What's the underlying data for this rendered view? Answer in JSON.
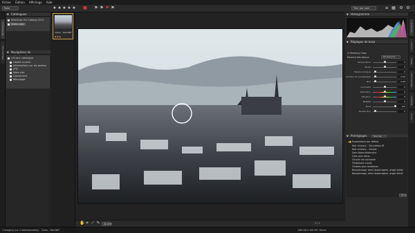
{
  "menu": [
    "Fichier",
    "Édition",
    "Affichage",
    "Aide"
  ],
  "toolbar": {
    "left_field": "Note",
    "right_field": "Trier par nom",
    "icons": [
      "back-icon",
      "forward-icon",
      "star-icon",
      "flag-icon",
      "rotate-icon",
      "settings-icon"
    ]
  },
  "left_tabs": [
    "Bibliothèque",
    "Métadonnées"
  ],
  "catalogs": {
    "title": "Catalogues",
    "items": [
      "AfterShot Pro Catalog 2012",
      "Vidéo.cata"
    ]
  },
  "metadata_nav": {
    "title": "Navigateur de métadonnées",
    "items": [
      "Cet jour catalogue",
      "Libellé couleur",
      "Informations sur les photos",
      "IPTC",
      "Mots-clés",
      "Classement",
      "Marquage"
    ]
  },
  "filmstrip": {
    "thumb_label": "Clubs - Test.NEF"
  },
  "histogram": {
    "title": "Histogramme"
  },
  "basic_settings": {
    "title": "Réglages de base",
    "sub_label": "Balance des blancs",
    "wb_value": "Tel que pris",
    "perfect_clear": "Perfectly Clear",
    "rows": [
      {
        "label": "Température",
        "value": "0"
      },
      {
        "label": "Teinte",
        "value": "0"
      },
      {
        "label": "Hautes lumières",
        "value": "0"
      },
      {
        "label": "Lumière de remplissage",
        "value": "0,00"
      },
      {
        "label": "Noir",
        "value": "0,00"
      },
      {
        "label": "Contraste",
        "value": "0"
      },
      {
        "label": "Saturation",
        "value": "0"
      },
      {
        "label": "Vibration",
        "value": "0"
      },
      {
        "label": "Netteté",
        "value": "0"
      },
      {
        "label": "Bruit",
        "value": "100"
      },
      {
        "label": "Niveau flou",
        "value": "0"
      }
    ]
  },
  "presets": {
    "title": "Préréglages",
    "header_field": "Tous les",
    "items": [
      "Pyramidales par défaut",
      "Noir et blanc - Simulation IR",
      "Noir et blanc - Simple",
      "Sans blanchissement",
      "Ciels plus bleus",
      "Couche de contraste",
      "Traitement croisé",
      "Ombres plus lointaines",
      "Remplissage, demi diaphragme, angle faible",
      "Remplissage, demi diaphragme, angle élevé"
    ],
    "button": "Nouv."
  },
  "right_tabs": [
    "Standard",
    "Couleur",
    "Détail",
    "Métadonnées",
    "Réglages",
    "Sortie"
  ],
  "viewer": {
    "zoom": "Ajuster",
    "position_label": "1 / 1"
  },
  "status": {
    "left": "1 image(s) sur 1 sélectionnée(s)",
    "file": "Clubs - Test.NEF",
    "right": "1/80 f/6.5 100 ISO 70mm"
  }
}
